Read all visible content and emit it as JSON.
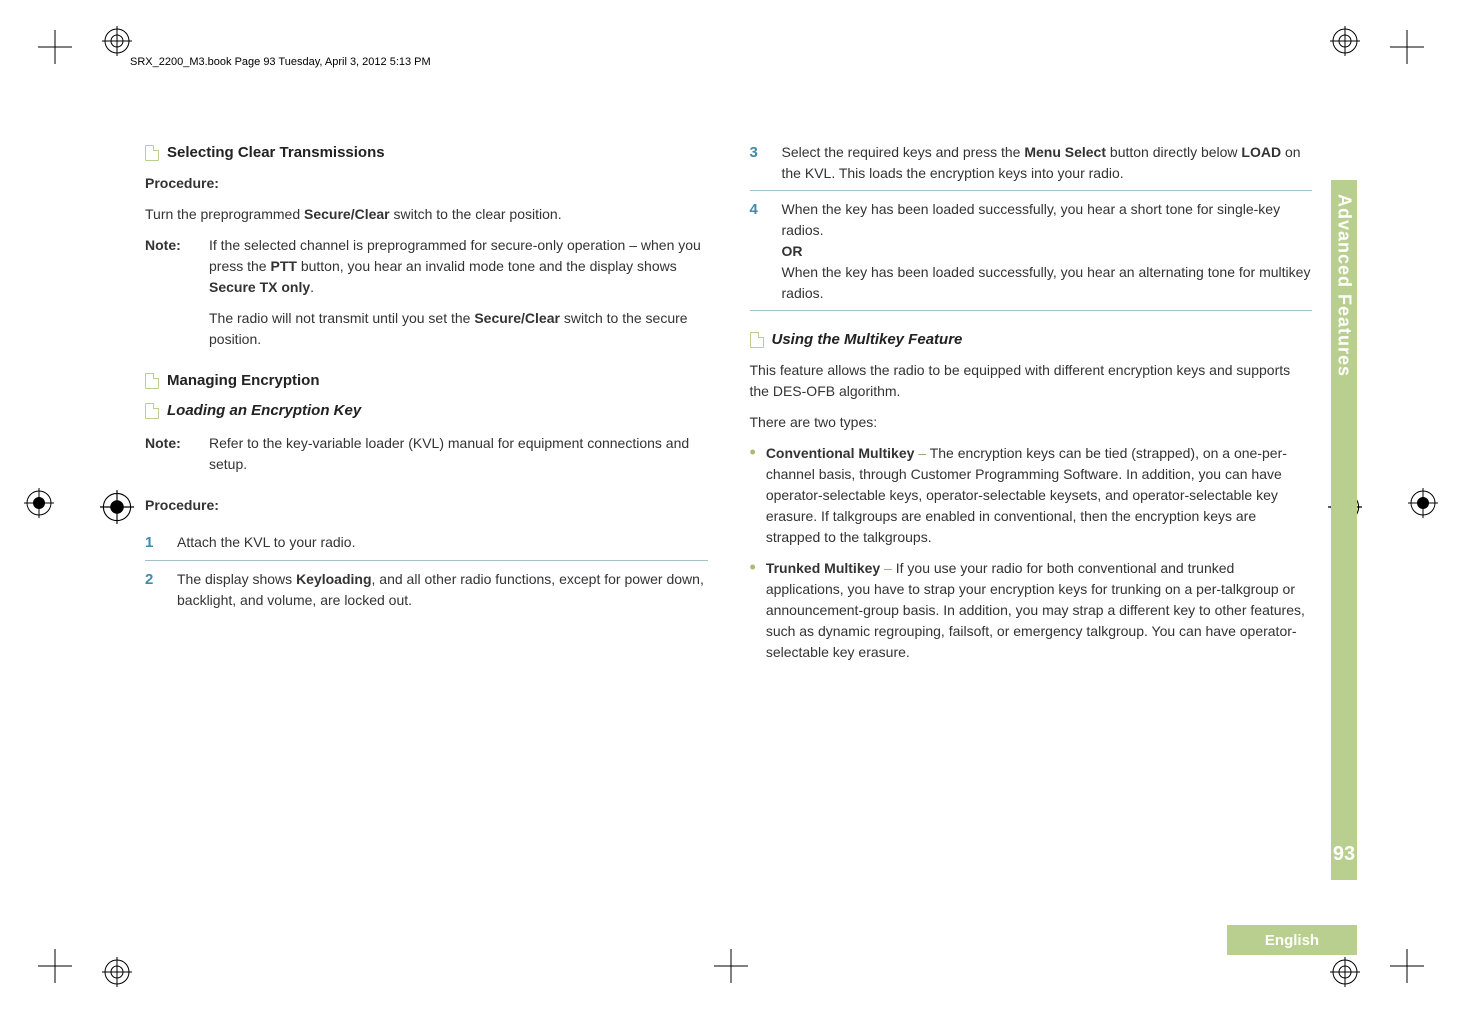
{
  "header": {
    "running": "SRX_2200_M3.book  Page 93  Tuesday, April 3, 2012  5:13 PM"
  },
  "left": {
    "sec1_title": "Selecting Clear Transmissions",
    "sec1_proc_label": "Procedure:",
    "sec1_proc_pre": "Turn the preprogrammed ",
    "sec1_proc_b": "Secure/Clear",
    "sec1_proc_post": " switch to the clear position.",
    "note_label": "Note:",
    "note1_a": "If the selected channel is preprogrammed for secure-only operation – when you press the ",
    "note1_b": "PTT",
    "note1_c": " button, you hear an invalid mode tone and the display shows ",
    "note1_d": "Secure TX only",
    "note1_e": ".",
    "note1_f": "The radio will not transmit until you set the ",
    "note1_g": "Secure/Clear",
    "note1_h": " switch to the secure position.",
    "sec2_title": "Managing Encryption",
    "sec3_title": "Loading an Encryption Key",
    "note2_label": "Note:",
    "note2_body": "Refer to the key-variable loader (KVL) manual for equipment connections and setup.",
    "proc2_label": "Procedure:",
    "step1": "Attach the KVL to your radio.",
    "step2_a": "The display shows ",
    "step2_b": "Keyloading",
    "step2_c": ", and all other radio functions, except for power down, backlight, and volume, are locked out."
  },
  "right": {
    "step3_a": "Select the required keys and press the ",
    "step3_b": "Menu Select",
    "step3_c": " button directly below ",
    "step3_d": "LOAD",
    "step3_e": " on the KVL. This loads the encryption keys into your radio.",
    "step4_a": "When the key has been loaded successfully, you hear a short tone for single-key radios.",
    "step4_or": "OR",
    "step4_b": "When the key has been loaded successfully, you hear an alternating tone for multikey radios.",
    "sec4_title": "Using the Multikey Feature",
    "sec4_p1": "This feature allows the radio to be equipped with different encryption keys and supports the DES-OFB algorithm.",
    "sec4_p2": "There are two types:",
    "b1_a": "Conventional Multikey",
    "b1_b": " – ",
    "b1_c": "The encryption keys can be tied (strapped), on a one-per-channel basis, through Customer Programming Software. In addition, you can have operator-selectable keys, operator-selectable keysets, and operator-selectable key erasure. If talkgroups are enabled in conventional, then the encryption keys are strapped to the talkgroups.",
    "b2_a": "Trunked Multikey",
    "b2_b": " – ",
    "b2_c": "If you use your radio for both conventional and trunked applications, you have to strap your encryption keys for trunking on a per-talkgroup or announcement-group basis. In addition, you may strap a different key to other features, such as dynamic regrouping, failsoft, or emergency talkgroup. You can have operator-selectable key erasure."
  },
  "sidebar": {
    "label": "Advanced Features",
    "page": "93",
    "lang": "English"
  },
  "steps_nums": {
    "n1": "1",
    "n2": "2",
    "n3": "3",
    "n4": "4"
  }
}
